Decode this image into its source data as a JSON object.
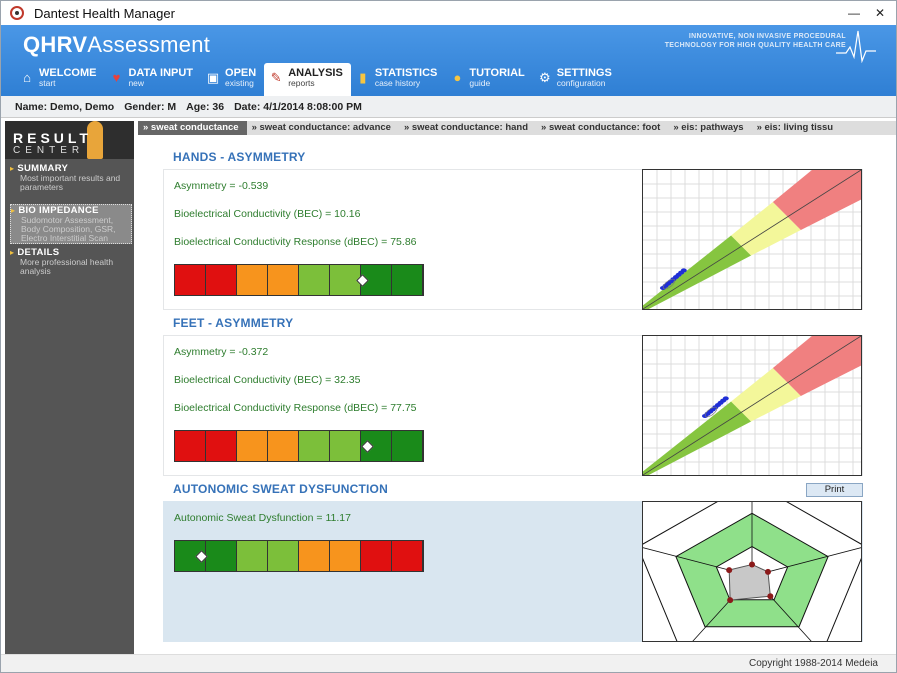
{
  "window": {
    "title": "Dantest Health Manager",
    "minimize": "—",
    "close": "✕"
  },
  "header": {
    "brand_bold": "QHRV",
    "brand_rest": "Assessment",
    "tagline_1": "INNOVATIVE, NON INVASIVE PROCEDURAL",
    "tagline_2": "TECHNOLOGY FOR HIGH QUALITY HEALTH CARE"
  },
  "nav": [
    {
      "title": "WELCOME",
      "sub": "start",
      "icon": "home-icon"
    },
    {
      "title": "DATA INPUT",
      "sub": "new",
      "icon": "heart-icon"
    },
    {
      "title": "OPEN",
      "sub": "existing",
      "icon": "floppy-icon"
    },
    {
      "title": "ANALYSIS",
      "sub": "reports",
      "icon": "report-icon"
    },
    {
      "title": "STATISTICS",
      "sub": "case history",
      "icon": "bar-chart-icon"
    },
    {
      "title": "TUTORIAL",
      "sub": "guide",
      "icon": "lightbulb-icon"
    },
    {
      "title": "SETTINGS",
      "sub": "configuration",
      "icon": "gear-icon"
    }
  ],
  "patient": {
    "name": "Name: Demo, Demo",
    "gender": "Gender: M",
    "age": "Age: 36",
    "date": "Date: 4/1/2014 8:08:00 PM"
  },
  "sidebar": {
    "rc_1": "RESULT",
    "rc_2": "CENTER",
    "items": [
      {
        "title": "SUMMARY",
        "desc": "Most important results and parameters"
      },
      {
        "title": "BIO IMPEDANCE",
        "desc": "Sudomotor Assessment, Body Composition, GSR, Electro Interstitial Scan"
      },
      {
        "title": "DETAILS",
        "desc": "More professional health analysis"
      }
    ]
  },
  "tabs": [
    "» sweat conductance",
    "» sweat conductance: advance",
    "» sweat conductance: hand",
    "» sweat conductance: foot",
    "» eis: pathways",
    "» eis: living tissu"
  ],
  "sections": {
    "hands": {
      "title": "HANDS - ASYMMETRY",
      "asym": "Asymmetry = -0.539",
      "bec": "Bioelectrical Conductivity (BEC) = 10.16",
      "dbec": "Bioelectrical Conductivity Response (dBEC) = 75.86",
      "marker_position": 0.76
    },
    "feet": {
      "title": "FEET - ASYMMETRY",
      "asym": "Asymmetry = -0.372",
      "bec": "Bioelectrical Conductivity (BEC) = 32.35",
      "dbec": "Bioelectrical Conductivity Response (dBEC) = 77.75",
      "marker_position": 0.78
    },
    "autonomic": {
      "title": "AUTONOMIC SWEAT DYSFUNCTION",
      "value": "Autonomic Sweat Dysfunction = 11.17",
      "marker_position": 0.11
    }
  },
  "print_label": "Print",
  "footer": "Copyright 1988-2014 Medeia",
  "colors": {
    "header_blue": "#3d8de0",
    "red": "#e01010",
    "orange": "#f7941d",
    "light_green": "#7cbf3a",
    "dark_green": "#1a8a1a",
    "title_blue": "#3672b8",
    "text_green": "#2e7d2e"
  }
}
